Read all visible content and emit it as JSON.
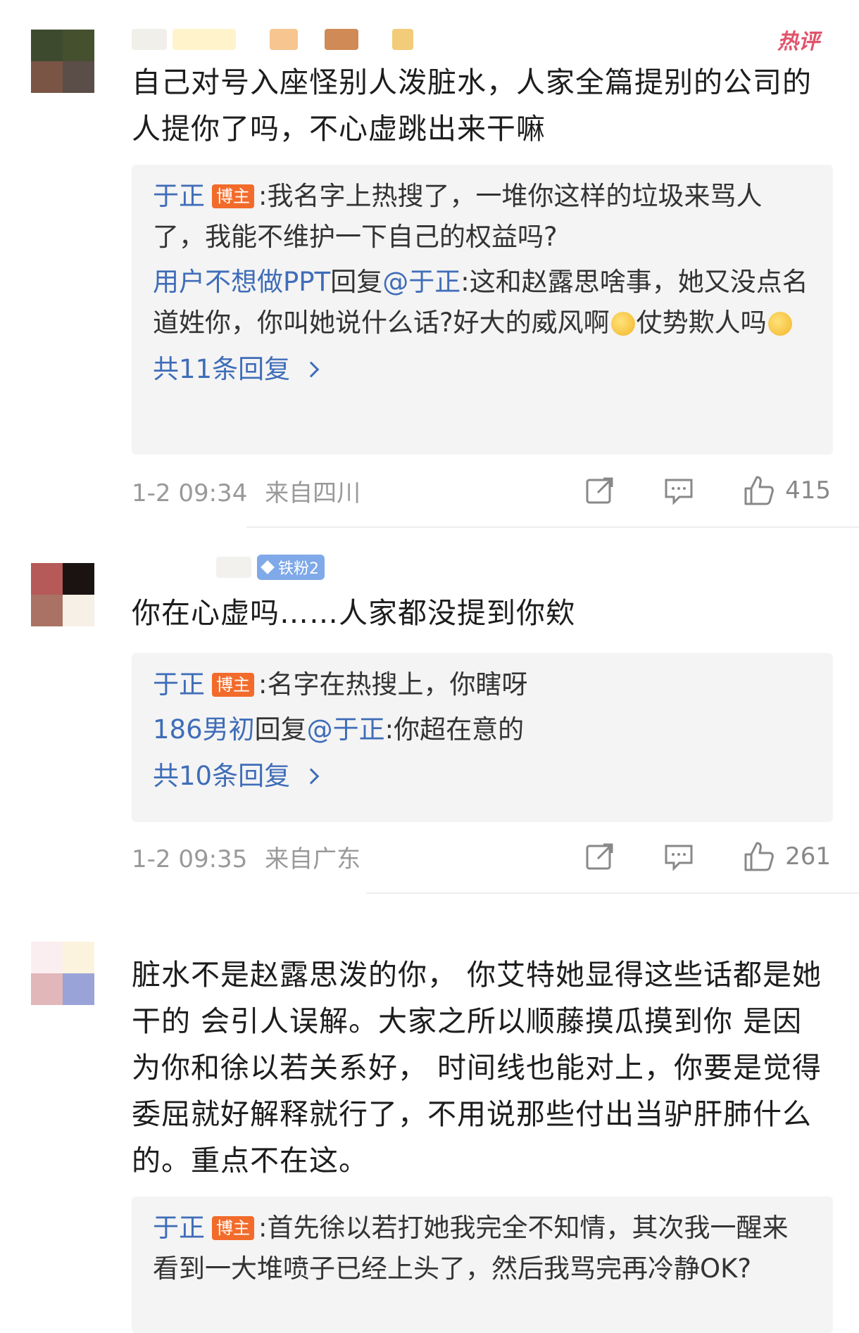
{
  "comments": [
    {
      "hot_label": "热评",
      "text": "自己对号入座怪别人泼脏水，人家全篇提别的公司的人提你了吗，不心虚跳出来干嘛",
      "replies": [
        {
          "user": "于正",
          "role": "博主",
          "text": ":我名字上热搜了，一堆你这样的垃圾来骂人了，我能不维护一下自己的权益吗?"
        },
        {
          "user": "用户不想做PPT",
          "reply_word": "回复",
          "mention": "@于正",
          "text_a": ":这和赵露思啥事，她又没点名道姓你，你叫她说什么话?好大的威风啊",
          "text_b": "仗势欺人吗"
        }
      ],
      "more": "共11条回复",
      "time": "1-2 09:34",
      "location": "来自四川",
      "likes": "415"
    },
    {
      "badge": "铁粉2",
      "text": "你在心虚吗……人家都没提到你欸",
      "replies": [
        {
          "user": "于正",
          "role": "博主",
          "text": ":名字在热搜上，你瞎呀"
        },
        {
          "user": "186男初",
          "reply_word": "回复",
          "mention": "@于正",
          "text": ":你超在意的"
        }
      ],
      "more": "共10条回复",
      "time": "1-2 09:35",
      "location": "来自广东",
      "likes": "261"
    },
    {
      "text": "脏水不是赵露思泼的你， 你艾特她显得这些话都是她干的 会引人误解。大家之所以顺藤摸瓜摸到你 是因为你和徐以若关系好， 时间线也能对上，你要是觉得委屈就好解释就行了，不用说那些付出当驴肝肺什么的。重点不在这。",
      "replies": [
        {
          "user": "于正",
          "role": "博主",
          "text": ":首先徐以若打她我完全不知情，其次我一醒来看到一大堆喷子已经上头了，然后我骂完再冷静OK?"
        }
      ]
    }
  ],
  "icons": {
    "share": "share-icon",
    "comment": "comment-icon",
    "like": "like-icon"
  },
  "colors": {
    "link_blue": "#3f6db8",
    "badge_orange": "#f26b2a",
    "hot_red": "#e0546b",
    "reply_bg": "#f4f4f4"
  }
}
